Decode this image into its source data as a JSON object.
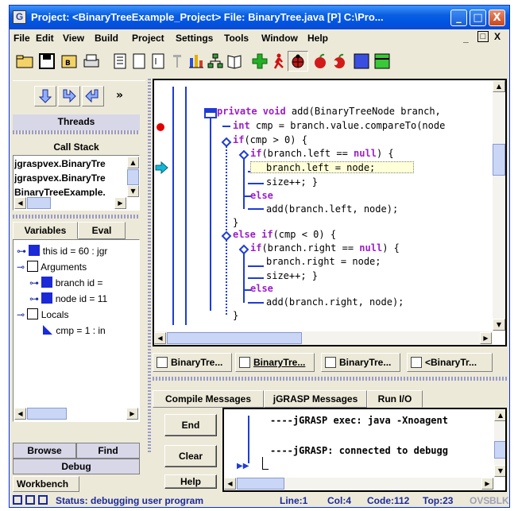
{
  "window": {
    "title": "Project: <BinaryTreeExample_Project>   File: BinaryTree.java [P]  C:\\Pro...",
    "controls": [
      "_",
      "□",
      "X"
    ]
  },
  "menu": [
    "File",
    "Edit",
    "View",
    "Build",
    "Project",
    "Settings",
    "Tools",
    "Window",
    "Help"
  ],
  "menu_right": [
    "_",
    "□",
    "X"
  ],
  "left_panel": {
    "threads_label": "Threads",
    "callstack_label": "Call Stack",
    "callstack_items": [
      "jgraspvex.BinaryTre",
      "jgraspvex.BinaryTre",
      "BinaryTreeExample."
    ],
    "tabs": [
      "Variables",
      "Eval"
    ],
    "variables": {
      "this": "this id = 60 : jgr",
      "arguments": "Arguments",
      "branch": "branch id =",
      "node": "node id = 11",
      "locals": "Locals",
      "cmp": "cmp = 1 : in"
    },
    "bottom_tabs": [
      "Browse",
      "Find",
      "Debug",
      "Workbench"
    ]
  },
  "code": {
    "lines": [
      {
        "indent": "",
        "parts": [
          {
            "t": "private void",
            "kw": true
          },
          {
            "t": " add(BinaryTreeNode branch,"
          }
        ]
      },
      {
        "indent": " ",
        "parts": [
          {
            "t": "int",
            "kw": true
          },
          {
            "t": " cmp = branch.value.compareTo(node"
          }
        ]
      },
      {
        "indent": "",
        "parts": [
          {
            "t": "if",
            "kw": true
          },
          {
            "t": "(cmp > 0) {"
          }
        ]
      },
      {
        "indent": "  ",
        "parts": [
          {
            "t": "if",
            "kw": true
          },
          {
            "t": "(branch.left == "
          },
          {
            "t": "null",
            "kw": true
          },
          {
            "t": ") {"
          }
        ]
      },
      {
        "indent": "   ",
        "parts": [
          {
            "t": "branch.left = node;"
          }
        ]
      },
      {
        "indent": "   ",
        "parts": [
          {
            "t": "size++; }"
          }
        ]
      },
      {
        "indent": "  ",
        "parts": [
          {
            "t": "else",
            "kw": true
          }
        ]
      },
      {
        "indent": "   ",
        "parts": [
          {
            "t": "add(branch.left, node);"
          }
        ]
      },
      {
        "indent": "  ",
        "parts": [
          {
            "t": "}"
          }
        ]
      },
      {
        "indent": "",
        "parts": [
          {
            "t": "else if",
            "kw": true
          },
          {
            "t": "(cmp < 0) {"
          }
        ]
      },
      {
        "indent": "  ",
        "parts": [
          {
            "t": "if",
            "kw": true
          },
          {
            "t": "(branch.right == "
          },
          {
            "t": "null",
            "kw": true
          },
          {
            "t": ") {"
          }
        ]
      },
      {
        "indent": "   ",
        "parts": [
          {
            "t": "branch.right = node;"
          }
        ]
      },
      {
        "indent": "   ",
        "parts": [
          {
            "t": "size++; }"
          }
        ]
      },
      {
        "indent": "  ",
        "parts": [
          {
            "t": "else",
            "kw": true
          }
        ]
      },
      {
        "indent": "   ",
        "parts": [
          {
            "t": "add(branch.right, node);"
          }
        ]
      },
      {
        "indent": "  ",
        "parts": [
          {
            "t": "}"
          }
        ]
      }
    ]
  },
  "doc_tabs": [
    "BinaryTre...",
    "BinaryTre...",
    "BinaryTre...",
    "<BinaryTr..."
  ],
  "message_tabs": [
    "Compile Messages",
    "jGRASP Messages",
    "Run I/O"
  ],
  "io_buttons": [
    "End",
    "Clear",
    "Help"
  ],
  "io_lines": [
    "----jGRASP exec: java -Xnoagent",
    "----jGRASP: connected to debugg"
  ],
  "status": {
    "text": "Status: debugging user program",
    "line": "Line:1",
    "col": "Col:4",
    "code": "Code:112",
    "top": "Top:23",
    "ovs": "OVS",
    "blk": "BLK"
  },
  "colors": {
    "keyword": "#9b1fc7",
    "breakpoint": "#e00000",
    "execution_arrow": "#00a0c0",
    "structure_line": "#1f3cd6"
  }
}
